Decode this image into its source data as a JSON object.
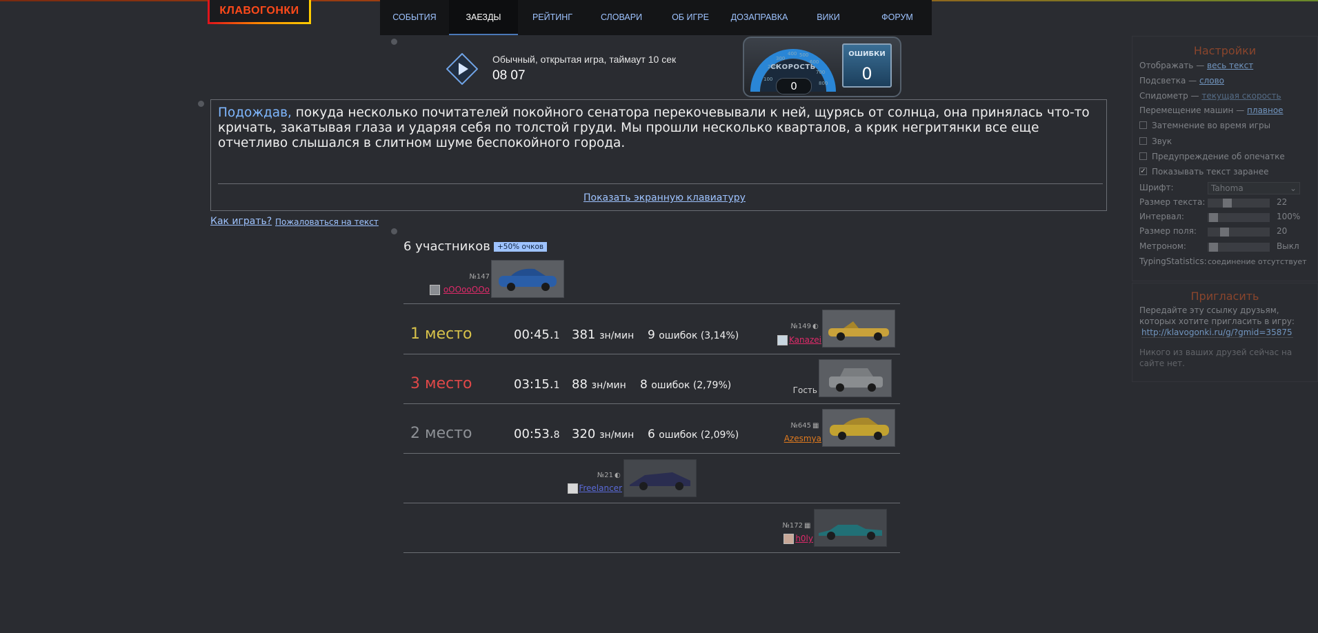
{
  "logo": "КЛАВОГОНКИ",
  "nav": [
    {
      "label": "СОБЫТИЯ",
      "active": false
    },
    {
      "label": "ЗАЕЗДЫ",
      "active": true
    },
    {
      "label": "РЕЙТИНГ",
      "active": false
    },
    {
      "label": "СЛОВАРИ",
      "active": false
    },
    {
      "label": "ОБ ИГРЕ",
      "active": false
    },
    {
      "label": "ДОЗАПРАВКА",
      "active": false
    },
    {
      "label": "ВИКИ",
      "active": false
    },
    {
      "label": "ФОРУМ",
      "active": false
    }
  ],
  "game": {
    "type": "Обычный, открытая игра, таймаут 10 сек",
    "timer": "08 07"
  },
  "speedometer": {
    "label": "СКОРОСТЬ",
    "value": "0",
    "ticks": [
      "100",
      "200",
      "300",
      "400",
      "500",
      "600",
      "700",
      "800"
    ],
    "errors_label": "ОШИБКИ",
    "errors_value": "0"
  },
  "text": {
    "typed": "Подождав,",
    "rest": " покуда несколько почитателей покойного сенатора перекочевывали к ней, щурясь от солнца, она принялась что-то кричать, закатывая глаза и ударяя себя по толстой груди. Мы прошли несколько кварталов, а крик негритянки все еще отчетливо слышался в слитном шуме беспокойного города.",
    "keyboard_link": "Показать экранную клавиатуру"
  },
  "links": {
    "how_to_play": "Как играть?",
    "complain": "Пожаловаться на текст"
  },
  "participants": {
    "count_label": "6 участников",
    "bonus": "+50% очков"
  },
  "players": [
    {
      "num": "№147",
      "name": "oOOooOOo",
      "color": "#e02a6a",
      "car_color": "#2a5ea8"
    },
    {
      "num": "№149",
      "name": "Kanazei",
      "color": "#e02a6a",
      "car_color": "#c9a23a",
      "place": "1 место",
      "place_color": "#d8c24a",
      "time_main": "00:45.",
      "time_frac": "1",
      "speed": "381",
      "speed_unit": "зн/мин",
      "errors": "9",
      "errors_text": "ошибок (3,14%)"
    },
    {
      "num": "",
      "name": "Гость",
      "color": "#d0d0d0",
      "car_color": "#8a8d90",
      "place": "3 место",
      "place_color": "#e04848",
      "time_main": "03:15.",
      "time_frac": "1",
      "speed": "88",
      "speed_unit": "зн/мин",
      "errors": "8",
      "errors_text": "ошибок (2,79%)"
    },
    {
      "num": "№645",
      "name": "Azesmya",
      "color": "#e07a1e",
      "car_color": "#c2a230",
      "place": "2 место",
      "place_color": "#8e9196",
      "time_main": "00:53.",
      "time_frac": "8",
      "speed": "320",
      "speed_unit": "зн/мин",
      "errors": "6",
      "errors_text": "ошибок (2,09%)"
    },
    {
      "num": "№21",
      "name": "Freelancer",
      "color": "#5a6ad8",
      "car_color": "#2a2e6a"
    },
    {
      "num": "№172",
      "name": "h0ly",
      "color": "#e02a6a",
      "car_color": "#1aa8b0"
    }
  ],
  "settings": {
    "title": "Настройки",
    "display_label": "Отображать —",
    "display_value": "весь текст",
    "highlight_label": "Подсветка —",
    "highlight_value": "слово",
    "speedo_label": "Спидометр —",
    "speedo_value": "текущая скорость",
    "move_label": "Перемещение машин —",
    "move_value": "плавное",
    "dim": "Затемнение во время игры",
    "sound": "Звук",
    "typo_warn": "Предупреждение об опечатке",
    "show_text": "Показывать текст заранее",
    "font_label": "Шрифт:",
    "font_value": "Tahoma",
    "text_size_label": "Размер текста:",
    "text_size_value": "22",
    "interval_label": "Интервал:",
    "interval_value": "100%",
    "field_size_label": "Размер поля:",
    "field_size_value": "20",
    "metronome_label": "Метроном:",
    "metronome_value": "Выкл",
    "ts_label": "TypingStatistics:",
    "ts_value": "соединение отсутствует"
  },
  "invite": {
    "title": "Пригласить",
    "desc": "Передайте эту ссылку друзьям, которых хотите пригласить в игру:",
    "link": "http://klavogonki.ru/g/?gmid=35875",
    "none": "Никого из ваших друзей сейчас на сайте нет."
  },
  "colors": {
    "accent": "#9ec3ff",
    "background": "#2a2c31"
  }
}
